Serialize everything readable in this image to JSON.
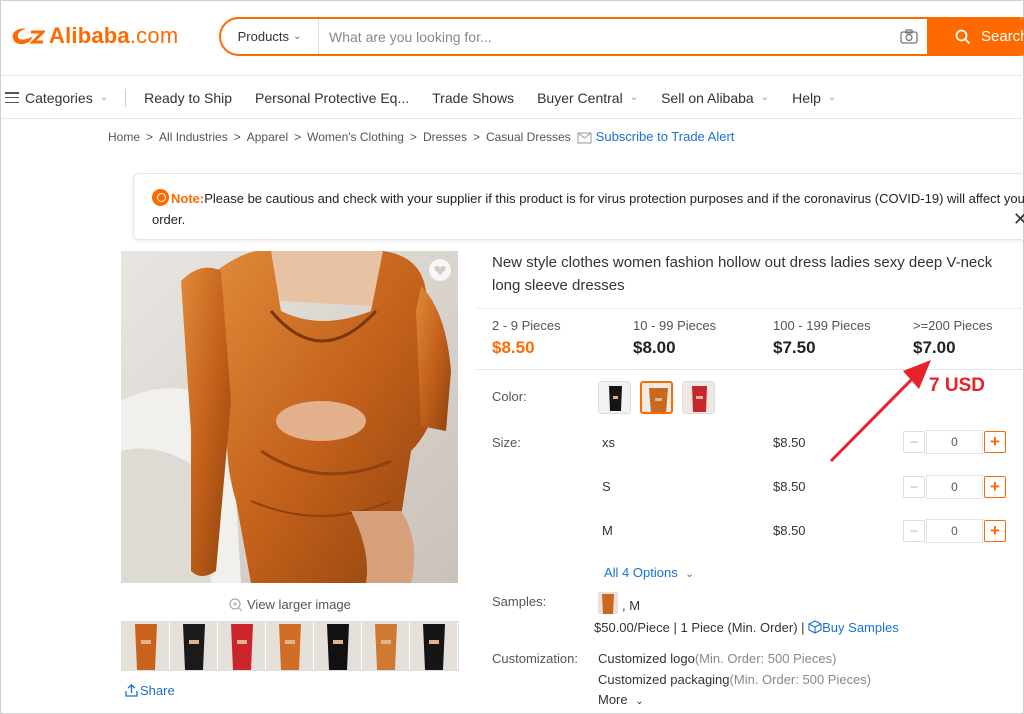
{
  "brand": {
    "name": "Alibaba",
    "suffix": ".com",
    "color": "#ff6a00"
  },
  "search": {
    "category": "Products",
    "placeholder": "What are you looking for...",
    "button_label": "Search"
  },
  "nav": {
    "items": [
      {
        "label": "Categories",
        "chevron": true
      },
      {
        "label": "Ready to Ship",
        "chevron": false
      },
      {
        "label": "Personal Protective Eq...",
        "chevron": false
      },
      {
        "label": "Trade Shows",
        "chevron": false
      },
      {
        "label": "Buyer Central",
        "chevron": true
      },
      {
        "label": "Sell on Alibaba",
        "chevron": true
      },
      {
        "label": "Help",
        "chevron": true
      }
    ]
  },
  "breadcrumb": {
    "items": [
      "Home",
      "All Industries",
      "Apparel",
      "Women's Clothing",
      "Dresses",
      "Casual Dresses"
    ],
    "subscribe": "Subscribe to Trade Alert"
  },
  "notice": {
    "label": "Note:",
    "text": "Please be cautious and check with your supplier if this product is for virus protection purposes and if the coronavirus (COVID-19) will affect your order."
  },
  "gallery": {
    "view_larger": "View larger image",
    "share": "Share",
    "thumb_colors": [
      "#c8621c",
      "#1a1a1a",
      "#c9252b",
      "#d06e28",
      "#111111",
      "#cf7a33",
      "#151515"
    ]
  },
  "product": {
    "title": "New style clothes women fashion hollow out dress ladies sexy deep V-neck long sleeve dresses",
    "tiers": [
      {
        "range": "2 - 9 Pieces",
        "price": "$8.50"
      },
      {
        "range": "10 - 99 Pieces",
        "price": "$8.00"
      },
      {
        "range": "100 - 199 Pieces",
        "price": "$7.50"
      },
      {
        "range": ">=200 Pieces",
        "price": "$7.00"
      }
    ],
    "color_label": "Color:",
    "colors": [
      "black",
      "orange",
      "red"
    ],
    "size_label": "Size:",
    "sizes": [
      {
        "name": "xs",
        "price": "$8.50",
        "qty": "0"
      },
      {
        "name": "S",
        "price": "$8.50",
        "qty": "0"
      },
      {
        "name": "M",
        "price": "$8.50",
        "qty": "0"
      }
    ],
    "all_options": "All 4 Options",
    "samples_label": "Samples:",
    "sample_size": ", M",
    "sample_price": "$50.00/Piece | 1 Piece (Min. Order) | ",
    "buy_samples": "Buy Samples",
    "customization_label": "Customization:",
    "customizations": [
      {
        "name": "Customized logo",
        "min": "(Min. Order: 500 Pieces)"
      },
      {
        "name": "Customized packaging",
        "min": "(Min. Order: 500 Pieces)"
      }
    ],
    "more": "More"
  },
  "annotation": {
    "text": "7 USD",
    "color": "#e8222b"
  }
}
